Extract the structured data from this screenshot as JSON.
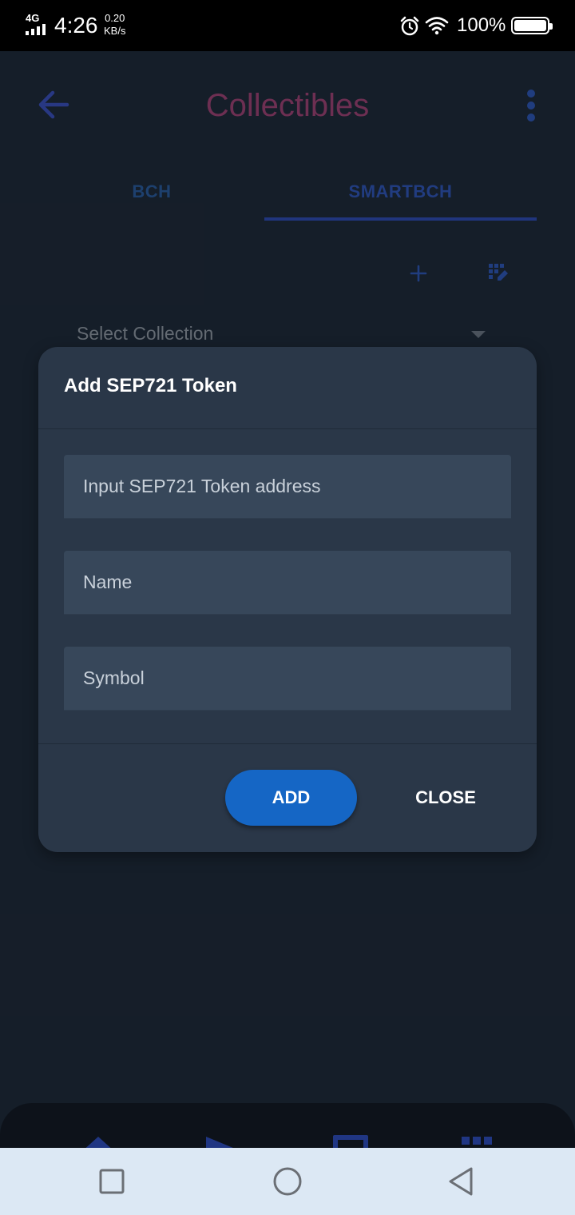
{
  "status_bar": {
    "network": "4G",
    "time": "4:26",
    "speed_value": "0.20",
    "speed_unit": "KB/s",
    "battery_pct": "100%",
    "icons": [
      "signal-icon",
      "alarm-icon",
      "wifi-icon",
      "battery-icon"
    ]
  },
  "header": {
    "title": "Collectibles",
    "back_icon": "arrow-left-icon",
    "menu_icon": "more-vertical-icon",
    "title_color": "#8c3d6a"
  },
  "tabs": [
    {
      "label": "BCH",
      "active": false
    },
    {
      "label": "SMARTBCH",
      "active": true
    }
  ],
  "toolbar": {
    "add_icon": "plus-icon",
    "edit_icon": "grid-edit-icon"
  },
  "collection_select": {
    "selected": "Select Collection"
  },
  "modal": {
    "title": "Add SEP721 Token",
    "fields": {
      "address_placeholder": "Input SEP721 Token address",
      "name_placeholder": "Name",
      "symbol_placeholder": "Symbol"
    },
    "add_label": "ADD",
    "close_label": "CLOSE",
    "accent": "#1566c5"
  },
  "bottom_nav": {
    "items": [
      "home-icon",
      "send-icon",
      "inbox-icon",
      "apps-icon"
    ],
    "color": "#2a46a8"
  },
  "system_nav": {
    "items": [
      "recents-icon",
      "home-circle-icon",
      "back-triangle-icon"
    ]
  }
}
